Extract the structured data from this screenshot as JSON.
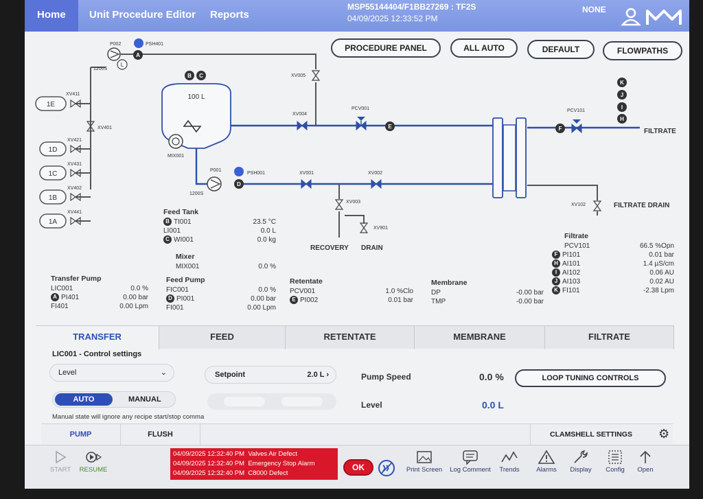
{
  "header": {
    "tabs": [
      "Home",
      "Unit Procedure Editor",
      "Reports"
    ],
    "batch_id": "MSP55144404/F1BB27269 : TF2S",
    "datetime": "04/09/2025   12:33:52 PM",
    "user": "NONE"
  },
  "top_buttons": [
    "PROCEDURE PANEL",
    "ALL AUTO",
    "DEFAULT",
    "FLOWPATHS"
  ],
  "diagram": {
    "tank_volume": "100 L",
    "tags": {
      "p002": "P002",
      "psh401": "PSH401",
      "xv411": "XV411",
      "xv401": "XV401",
      "xv421": "XV421",
      "xv431": "XV431",
      "xv402": "XV402",
      "xv441": "XV441",
      "mix001": "MIX001",
      "p001": "P001",
      "psh001": "PSH001",
      "xv005": "XV005",
      "xv004": "XV004",
      "pcv001": "PCV001",
      "xv001": "XV001",
      "xv002": "XV002",
      "xv003": "XV003",
      "xv901": "XV901",
      "pcv101": "PCV101",
      "xv102": "XV102",
      "code1": "1200S",
      "code2": "1200S"
    },
    "sources": [
      "1E",
      "1D",
      "1C",
      "1B",
      "1A"
    ],
    "outlets": {
      "recovery": "RECOVERY",
      "drain": "DRAIN",
      "filtrate": "FILTRATE",
      "filtrate_drain": "FILTRATE DRAIN"
    }
  },
  "panels": {
    "transfer_pump": {
      "title": "Transfer Pump",
      "rows": [
        [
          "LIC001",
          "0.0 %"
        ],
        [
          "PI401",
          "0.00 bar"
        ],
        [
          "FI401",
          "0.00 Lpm"
        ]
      ]
    },
    "feed_tank": {
      "title": "Feed Tank",
      "rows": [
        [
          "TI001",
          "23.5 °C"
        ],
        [
          "LI001",
          "0.0 L"
        ],
        [
          "WI001",
          "0.0 kg"
        ]
      ]
    },
    "mixer": {
      "title": "Mixer",
      "rows": [
        [
          "MIX001",
          "0.0 %"
        ]
      ]
    },
    "feed_pump": {
      "title": "Feed Pump",
      "rows": [
        [
          "FIC001",
          "0.0 %"
        ],
        [
          "PI001",
          "0.00 bar"
        ],
        [
          "FI001",
          "0.00 Lpm"
        ]
      ]
    },
    "retentate": {
      "title": "Retentate",
      "rows": [
        [
          "PCV001",
          "1.0 %Clo"
        ],
        [
          "PI002",
          "0.01 bar"
        ]
      ]
    },
    "membrane": {
      "title": "Membrane",
      "rows": [
        [
          "DP",
          "-0.00 bar"
        ],
        [
          "TMP",
          "-0.00 bar"
        ]
      ]
    },
    "filtrate": {
      "title": "Filtrate",
      "rows": [
        [
          "PCV101",
          "66.5 %Opn"
        ],
        [
          "PI101",
          "0.01 bar"
        ],
        [
          "AI101",
          "1.4 µS/cm"
        ],
        [
          "AI102",
          "0.06 AU"
        ],
        [
          "AI103",
          "0.02 AU"
        ],
        [
          "FI101",
          "-2.38 Lpm"
        ]
      ]
    }
  },
  "tabs": [
    "TRANSFER",
    "FEED",
    "RETENTATE",
    "MEMBRANE",
    "FILTRATE"
  ],
  "controls": {
    "title": "LIC001 - Control settings",
    "mode_select": "Level",
    "setpoint_label": "Setpoint",
    "setpoint_value": "2.0 L",
    "pump_speed_label": "Pump Speed",
    "pump_speed_value": "0.0 %",
    "level_label": "Level",
    "level_value": "0.0 L",
    "loop_button": "LOOP TUNING CONTROLS",
    "auto": "AUTO",
    "manual": "MANUAL",
    "note": "Manual state will ignore any recipe start/stop comma"
  },
  "subtabs": [
    "PUMP",
    "FLUSH"
  ],
  "clamshell": "CLAMSHELL SETTINGS",
  "bottom": {
    "start": "START",
    "resume": "RESUME",
    "alarms": [
      [
        "04/09/2025 12:32:40 PM",
        "Valves Air Defect"
      ],
      [
        "04/09/2025 12:32:40 PM",
        "Emergency Stop Alarm"
      ],
      [
        "04/09/2025 12:32:40 PM",
        "C8000 Defect"
      ]
    ],
    "ok": "OK",
    "tools": [
      "Print Screen",
      "Log Comment",
      "Trends",
      "Alarms",
      "Display",
      "Config",
      "Open"
    ]
  },
  "colors": {
    "accent": "#2d4fb8",
    "pipe": "#2f4fa8",
    "alarm": "#d8182a",
    "header": "#7b95e2"
  }
}
